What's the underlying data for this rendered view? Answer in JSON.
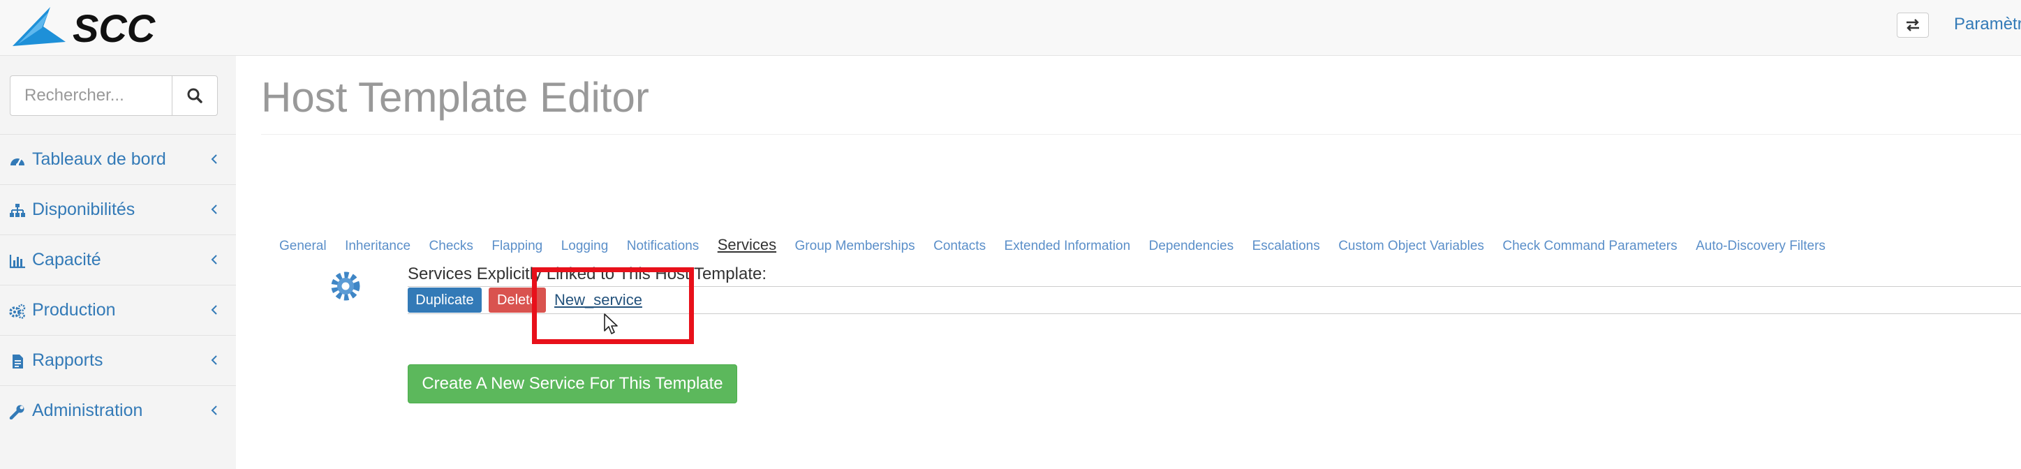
{
  "header": {
    "logo_text": "SCC",
    "logo_icon": "scc-swoosh-logo",
    "swap_icon": "swap-arrows-icon",
    "params_label": "Paramètr"
  },
  "sidebar": {
    "search": {
      "placeholder": "Rechercher...",
      "value": "",
      "icon": "search-icon"
    },
    "items": [
      {
        "label": "Tableaux de bord",
        "icon": "dashboard-icon"
      },
      {
        "label": "Disponibilités",
        "icon": "sitemap-icon"
      },
      {
        "label": "Capacité",
        "icon": "bar-chart-icon"
      },
      {
        "label": "Production",
        "icon": "gears-icon"
      },
      {
        "label": "Rapports",
        "icon": "file-icon"
      },
      {
        "label": "Administration",
        "icon": "wrench-icon"
      }
    ]
  },
  "main": {
    "title": "Host Template Editor",
    "tabs": [
      {
        "label": "General",
        "active": false
      },
      {
        "label": "Inheritance",
        "active": false
      },
      {
        "label": "Checks",
        "active": false
      },
      {
        "label": "Flapping",
        "active": false
      },
      {
        "label": "Logging",
        "active": false
      },
      {
        "label": "Notifications",
        "active": false
      },
      {
        "label": "Services",
        "active": true
      },
      {
        "label": "Group Memberships",
        "active": false
      },
      {
        "label": "Contacts",
        "active": false
      },
      {
        "label": "Extended Information",
        "active": false
      },
      {
        "label": "Dependencies",
        "active": false
      },
      {
        "label": "Escalations",
        "active": false
      },
      {
        "label": "Custom Object Variables",
        "active": false
      },
      {
        "label": "Check Command Parameters",
        "active": false
      },
      {
        "label": "Auto-Discovery Filters",
        "active": false
      }
    ],
    "services": {
      "heading": "Services Explicitly Linked to This Host Template:",
      "duplicate_label": "Duplicate",
      "delete_label": "Delete",
      "service_name": "New_service",
      "create_label": "Create A New Service For This Template"
    },
    "colors": {
      "primary": "#337ab7",
      "danger": "#d9534f",
      "success": "#5cb85c",
      "highlight": "#e8101a"
    }
  }
}
